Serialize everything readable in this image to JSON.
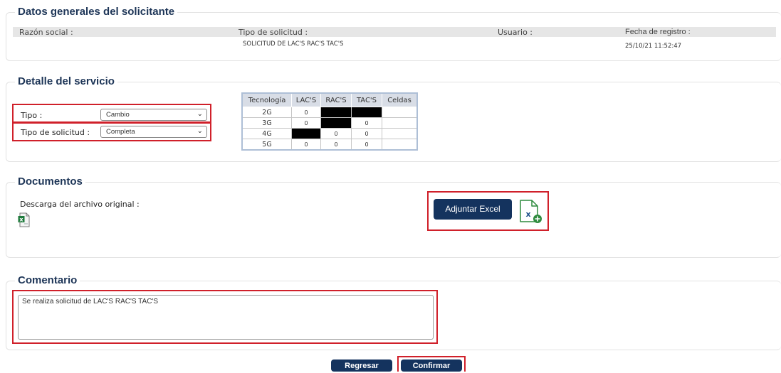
{
  "datos": {
    "title": "Datos generales del solicitante",
    "razon_label": "Razón social :",
    "tipo_label": "Tipo de solicitud :",
    "tipo_value": "SOLICITUD DE LAC'S RAC'S TAC'S",
    "usuario_label": "Usuario :",
    "fecha_label": "Fecha de registro :",
    "fecha_value": "25/10/21 11:52:47"
  },
  "detalle": {
    "title": "Detalle del servicio",
    "tipo_label": "Tipo :",
    "tipo_value": "Cambio",
    "tipo_sol_label": "Tipo de solicitud :",
    "tipo_sol_value": "Completa",
    "table": {
      "headers": [
        "Tecnología",
        "LAC'S",
        "RAC'S",
        "TAC'S",
        "Celdas"
      ],
      "rows": [
        [
          "2G",
          "0",
          "",
          "",
          ""
        ],
        [
          "3G",
          "0",
          "",
          "0",
          ""
        ],
        [
          "4G",
          "",
          "0",
          "0",
          ""
        ],
        [
          "5G",
          "0",
          "0",
          "0",
          ""
        ]
      ]
    }
  },
  "documentos": {
    "title": "Documentos",
    "descarga_label": "Descarga del archivo original :",
    "adjuntar_label": "Adjuntar Excel",
    "excel_icon": "excel-file-icon",
    "excel_add_icon": "excel-add-icon"
  },
  "comentario": {
    "title": "Comentario",
    "value": "Se realiza solicitud de LAC'S RAC'S TAC'S"
  },
  "actions": {
    "regresar_label": "Regresar",
    "confirmar_label": "Confirmar"
  },
  "colors": {
    "accent": "#14335e",
    "highlight": "#d0202a"
  }
}
